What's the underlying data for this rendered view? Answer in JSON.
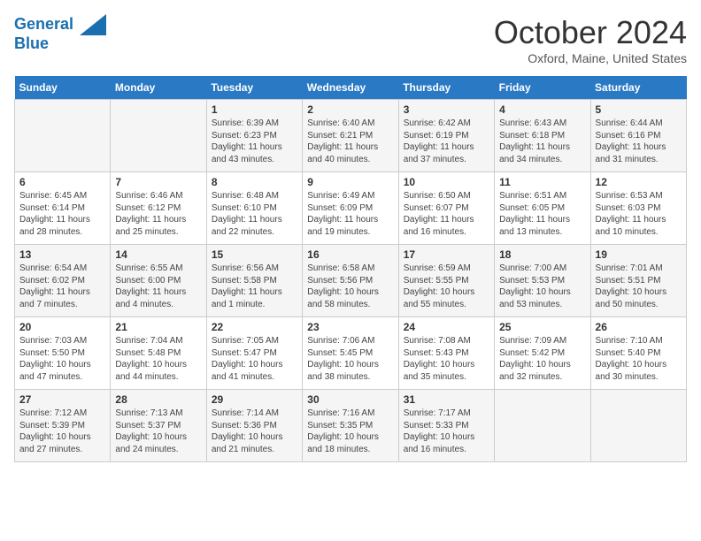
{
  "header": {
    "logo_line1": "General",
    "logo_line2": "Blue",
    "month": "October 2024",
    "location": "Oxford, Maine, United States"
  },
  "columns": [
    "Sunday",
    "Monday",
    "Tuesday",
    "Wednesday",
    "Thursday",
    "Friday",
    "Saturday"
  ],
  "weeks": [
    [
      {
        "day": "",
        "detail": ""
      },
      {
        "day": "",
        "detail": ""
      },
      {
        "day": "1",
        "detail": "Sunrise: 6:39 AM\nSunset: 6:23 PM\nDaylight: 11 hours and 43 minutes."
      },
      {
        "day": "2",
        "detail": "Sunrise: 6:40 AM\nSunset: 6:21 PM\nDaylight: 11 hours and 40 minutes."
      },
      {
        "day": "3",
        "detail": "Sunrise: 6:42 AM\nSunset: 6:19 PM\nDaylight: 11 hours and 37 minutes."
      },
      {
        "day": "4",
        "detail": "Sunrise: 6:43 AM\nSunset: 6:18 PM\nDaylight: 11 hours and 34 minutes."
      },
      {
        "day": "5",
        "detail": "Sunrise: 6:44 AM\nSunset: 6:16 PM\nDaylight: 11 hours and 31 minutes."
      }
    ],
    [
      {
        "day": "6",
        "detail": "Sunrise: 6:45 AM\nSunset: 6:14 PM\nDaylight: 11 hours and 28 minutes."
      },
      {
        "day": "7",
        "detail": "Sunrise: 6:46 AM\nSunset: 6:12 PM\nDaylight: 11 hours and 25 minutes."
      },
      {
        "day": "8",
        "detail": "Sunrise: 6:48 AM\nSunset: 6:10 PM\nDaylight: 11 hours and 22 minutes."
      },
      {
        "day": "9",
        "detail": "Sunrise: 6:49 AM\nSunset: 6:09 PM\nDaylight: 11 hours and 19 minutes."
      },
      {
        "day": "10",
        "detail": "Sunrise: 6:50 AM\nSunset: 6:07 PM\nDaylight: 11 hours and 16 minutes."
      },
      {
        "day": "11",
        "detail": "Sunrise: 6:51 AM\nSunset: 6:05 PM\nDaylight: 11 hours and 13 minutes."
      },
      {
        "day": "12",
        "detail": "Sunrise: 6:53 AM\nSunset: 6:03 PM\nDaylight: 11 hours and 10 minutes."
      }
    ],
    [
      {
        "day": "13",
        "detail": "Sunrise: 6:54 AM\nSunset: 6:02 PM\nDaylight: 11 hours and 7 minutes."
      },
      {
        "day": "14",
        "detail": "Sunrise: 6:55 AM\nSunset: 6:00 PM\nDaylight: 11 hours and 4 minutes."
      },
      {
        "day": "15",
        "detail": "Sunrise: 6:56 AM\nSunset: 5:58 PM\nDaylight: 11 hours and 1 minute."
      },
      {
        "day": "16",
        "detail": "Sunrise: 6:58 AM\nSunset: 5:56 PM\nDaylight: 10 hours and 58 minutes."
      },
      {
        "day": "17",
        "detail": "Sunrise: 6:59 AM\nSunset: 5:55 PM\nDaylight: 10 hours and 55 minutes."
      },
      {
        "day": "18",
        "detail": "Sunrise: 7:00 AM\nSunset: 5:53 PM\nDaylight: 10 hours and 53 minutes."
      },
      {
        "day": "19",
        "detail": "Sunrise: 7:01 AM\nSunset: 5:51 PM\nDaylight: 10 hours and 50 minutes."
      }
    ],
    [
      {
        "day": "20",
        "detail": "Sunrise: 7:03 AM\nSunset: 5:50 PM\nDaylight: 10 hours and 47 minutes."
      },
      {
        "day": "21",
        "detail": "Sunrise: 7:04 AM\nSunset: 5:48 PM\nDaylight: 10 hours and 44 minutes."
      },
      {
        "day": "22",
        "detail": "Sunrise: 7:05 AM\nSunset: 5:47 PM\nDaylight: 10 hours and 41 minutes."
      },
      {
        "day": "23",
        "detail": "Sunrise: 7:06 AM\nSunset: 5:45 PM\nDaylight: 10 hours and 38 minutes."
      },
      {
        "day": "24",
        "detail": "Sunrise: 7:08 AM\nSunset: 5:43 PM\nDaylight: 10 hours and 35 minutes."
      },
      {
        "day": "25",
        "detail": "Sunrise: 7:09 AM\nSunset: 5:42 PM\nDaylight: 10 hours and 32 minutes."
      },
      {
        "day": "26",
        "detail": "Sunrise: 7:10 AM\nSunset: 5:40 PM\nDaylight: 10 hours and 30 minutes."
      }
    ],
    [
      {
        "day": "27",
        "detail": "Sunrise: 7:12 AM\nSunset: 5:39 PM\nDaylight: 10 hours and 27 minutes."
      },
      {
        "day": "28",
        "detail": "Sunrise: 7:13 AM\nSunset: 5:37 PM\nDaylight: 10 hours and 24 minutes."
      },
      {
        "day": "29",
        "detail": "Sunrise: 7:14 AM\nSunset: 5:36 PM\nDaylight: 10 hours and 21 minutes."
      },
      {
        "day": "30",
        "detail": "Sunrise: 7:16 AM\nSunset: 5:35 PM\nDaylight: 10 hours and 18 minutes."
      },
      {
        "day": "31",
        "detail": "Sunrise: 7:17 AM\nSunset: 5:33 PM\nDaylight: 10 hours and 16 minutes."
      },
      {
        "day": "",
        "detail": ""
      },
      {
        "day": "",
        "detail": ""
      }
    ]
  ]
}
